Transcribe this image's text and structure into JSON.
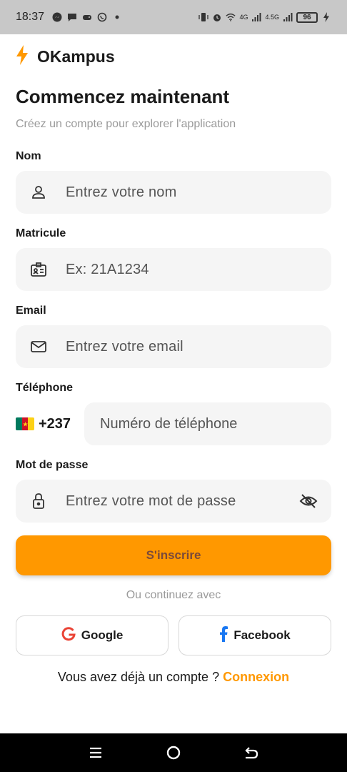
{
  "status_bar": {
    "time": "18:37",
    "notif_icons": [
      "messenger-icon",
      "chat-icon",
      "game-controller-icon",
      "whatsapp-icon",
      "dot-icon"
    ],
    "net1": "4G",
    "net2": "4.5G",
    "battery": "96"
  },
  "brand": {
    "name": "OKampus",
    "icon": "lightning-bolt-icon",
    "color": "#ff9800"
  },
  "header": {
    "title": "Commencez maintenant",
    "subtitle": "Créez un compte pour explorer l'application"
  },
  "form": {
    "name": {
      "label": "Nom",
      "placeholder": "Entrez votre nom",
      "icon": "person-icon"
    },
    "matricule": {
      "label": "Matricule",
      "placeholder": "Ex: 21A1234",
      "icon": "id-card-icon"
    },
    "email": {
      "label": "Email",
      "placeholder": "Entrez votre email",
      "icon": "envelope-icon"
    },
    "phone": {
      "label": "Téléphone",
      "country_code": "+237",
      "placeholder": "Numéro de téléphone",
      "flag": "cameroon-flag-icon"
    },
    "password": {
      "label": "Mot de passe",
      "placeholder": "Entrez votre mot de passe",
      "icon": "lock-icon",
      "toggle_icon": "eye-off-icon"
    },
    "submit_label": "S'inscrire"
  },
  "alt": {
    "divider": "Ou continuez avec",
    "google_label": "Google",
    "facebook_label": "Facebook"
  },
  "footer": {
    "prompt": "Vous avez déjà un compte ? ",
    "link": "Connexion"
  },
  "colors": {
    "accent": "#ff9800",
    "field_bg": "#f5f5f5",
    "google_red": "#ea4335",
    "facebook_blue": "#1877f2"
  }
}
